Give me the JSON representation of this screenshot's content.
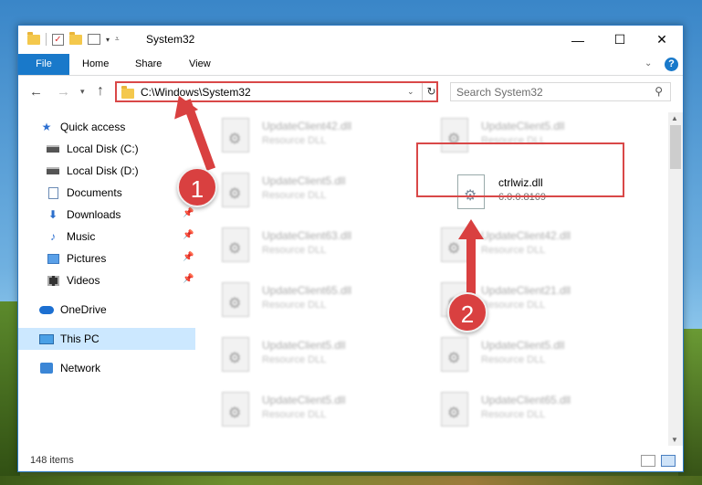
{
  "window": {
    "title": "System32",
    "controls": {
      "minimize": "—",
      "maximize": "☐",
      "close": "✕"
    }
  },
  "ribbon": {
    "tabs": [
      "File",
      "Home",
      "Share",
      "View"
    ]
  },
  "nav": {
    "address": "C:\\Windows\\System32",
    "search_placeholder": "Search System32"
  },
  "sidebar": {
    "items": [
      {
        "label": "Quick access",
        "icon": "star-icon"
      },
      {
        "label": "Local Disk (C:)",
        "icon": "drive-icon"
      },
      {
        "label": "Local Disk (D:)",
        "icon": "drive-icon"
      },
      {
        "label": "Documents",
        "icon": "documents-icon"
      },
      {
        "label": "Downloads",
        "icon": "download-icon",
        "pinned": true
      },
      {
        "label": "Music",
        "icon": "music-icon",
        "pinned": true
      },
      {
        "label": "Pictures",
        "icon": "pictures-icon",
        "pinned": true
      },
      {
        "label": "Videos",
        "icon": "videos-icon",
        "pinned": true
      },
      {
        "label": "OneDrive",
        "icon": "onedrive-icon"
      },
      {
        "label": "This PC",
        "icon": "pc-icon",
        "selected": true
      },
      {
        "label": "Network",
        "icon": "network-icon"
      }
    ]
  },
  "files": {
    "left": [
      {
        "name": "UpdateClient42.dll",
        "desc": "Resource DLL"
      },
      {
        "name": "UpdateClient5.dll",
        "desc": "Resource DLL"
      },
      {
        "name": "UpdateClient63.dll",
        "desc": "Resource DLL"
      },
      {
        "name": "UpdateClient65.dll",
        "desc": "Resource DLL"
      },
      {
        "name": "UpdateClient5.dll",
        "desc": "Resource DLL"
      },
      {
        "name": "UpdateClient5.dll",
        "desc": "Resource DLL"
      }
    ],
    "right": [
      {
        "name": "UpdateClient5.dll",
        "desc": "Resource DLL"
      },
      {
        "name": "ctrlwiz.dll",
        "desc": "6.0.0.8169"
      },
      {
        "name": "UpdateClient42.dll",
        "desc": "Resource DLL"
      },
      {
        "name": "UpdateClient21.dll",
        "desc": "Resource DLL"
      },
      {
        "name": "UpdateClient5.dll",
        "desc": "Resource DLL"
      },
      {
        "name": "UpdateClient65.dll",
        "desc": "Resource DLL"
      }
    ]
  },
  "status": {
    "item_count": "148 items"
  },
  "callouts": {
    "step1": "1",
    "step2": "2"
  },
  "colors": {
    "accent": "#1979ca",
    "highlight": "#d94848",
    "selected": "#cce8ff"
  }
}
